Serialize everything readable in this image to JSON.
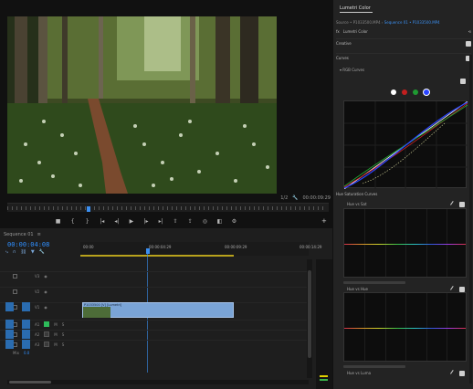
{
  "monitor": {
    "fit_label": "1/2",
    "wrench_icon": "wrench-icon",
    "timecode": "00:00:09:29",
    "transport": [
      {
        "name": "add-marker-button",
        "glyph": "■"
      },
      {
        "name": "mark-in-button",
        "glyph": "{"
      },
      {
        "name": "mark-out-button",
        "glyph": "}"
      },
      {
        "name": "go-to-in-button",
        "glyph": "|◂"
      },
      {
        "name": "step-back-button",
        "glyph": "◂|"
      },
      {
        "name": "play-button",
        "glyph": "▶"
      },
      {
        "name": "step-forward-button",
        "glyph": "|▸"
      },
      {
        "name": "go-to-out-button",
        "glyph": "▸|"
      },
      {
        "name": "lift-button",
        "glyph": "⇧"
      },
      {
        "name": "extract-button",
        "glyph": "⇪"
      },
      {
        "name": "export-frame-button",
        "glyph": "◎"
      },
      {
        "name": "comparison-view-button",
        "glyph": "◧"
      },
      {
        "name": "toggle-proxies-button",
        "glyph": "⚙"
      }
    ],
    "add_button": "+"
  },
  "timeline": {
    "tab": "Sequence 01",
    "tab_menu": "≡",
    "close": "×",
    "timecode": "00:00:04:08",
    "ruler_labels": [
      "00:00",
      "00:00:04:29",
      "00:00:09:29",
      "00:00:14:29"
    ],
    "tracks": [
      {
        "id": "V3",
        "kind": "video"
      },
      {
        "id": "V2",
        "kind": "video"
      },
      {
        "id": "V1",
        "kind": "video"
      },
      {
        "id": "A1",
        "kind": "audio",
        "mute": "M",
        "solo": "S"
      },
      {
        "id": "A2",
        "kind": "audio",
        "mute": "M",
        "solo": "S"
      },
      {
        "id": "A3",
        "kind": "audio",
        "mute": "M",
        "solo": "S"
      }
    ],
    "master": {
      "label": "Mix",
      "value": "0.0"
    },
    "clip_name": "P1033500 [V] [Lumetri]"
  },
  "panel": {
    "title": "Lumetri Color",
    "source_prefix": "Source • P1033500.MP4 ›",
    "source_link": "Sequence 01 • P1033500.MP4",
    "fx_label": "fx",
    "fx_name": "Lumetri Color",
    "sections": [
      {
        "label": "Creative"
      },
      {
        "label": "Curves"
      }
    ],
    "rgb_curves_label": "RGB Curves",
    "hsc_section": "Hue Saturation Curves",
    "hsc_boxes": [
      "Hue vs Sat",
      "Hue vs Hue",
      "Hue vs Luma"
    ]
  },
  "colors": {
    "accent": "#3b8ff0",
    "clip": "#7aa4d6",
    "work_area": "#b8a21c",
    "mute_on": "#2dbb5a",
    "curve_white": "#ffffff",
    "curve_red": "#cc2222",
    "curve_green": "#22aa33",
    "curve_blue": "#2a44ff"
  }
}
